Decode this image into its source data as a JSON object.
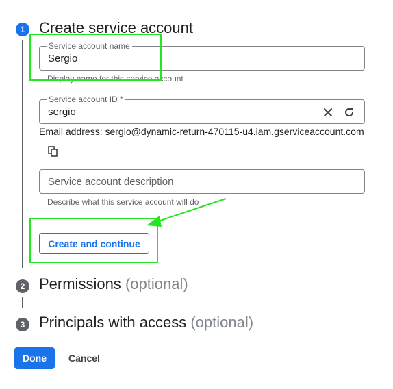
{
  "steps": [
    {
      "number": "1",
      "title": "Create service account",
      "optional": ""
    },
    {
      "number": "2",
      "title": "Permissions",
      "optional": "(optional)"
    },
    {
      "number": "3",
      "title": "Principals with access",
      "optional": "(optional)"
    }
  ],
  "form": {
    "name_field": {
      "label": "Service account name",
      "value": "Sergio",
      "helper": "Display name for this service account"
    },
    "id_field": {
      "label": "Service account ID *",
      "value": "sergio"
    },
    "email_line": "Email address: sergio@dynamic-return-470115-u4.iam.gserviceaccount.com",
    "description_field": {
      "placeholder": "Service account description",
      "helper": "Describe what this service account will do"
    },
    "create_button": "Create and continue"
  },
  "footer": {
    "done_label": "Done",
    "cancel_label": "Cancel"
  },
  "icons": {
    "clear": "close-icon",
    "refresh": "refresh-icon",
    "copy": "copy-icon"
  },
  "colors": {
    "accent": "#1a73e8",
    "inactive_step": "#5f6368",
    "annotation": "#22e622"
  }
}
